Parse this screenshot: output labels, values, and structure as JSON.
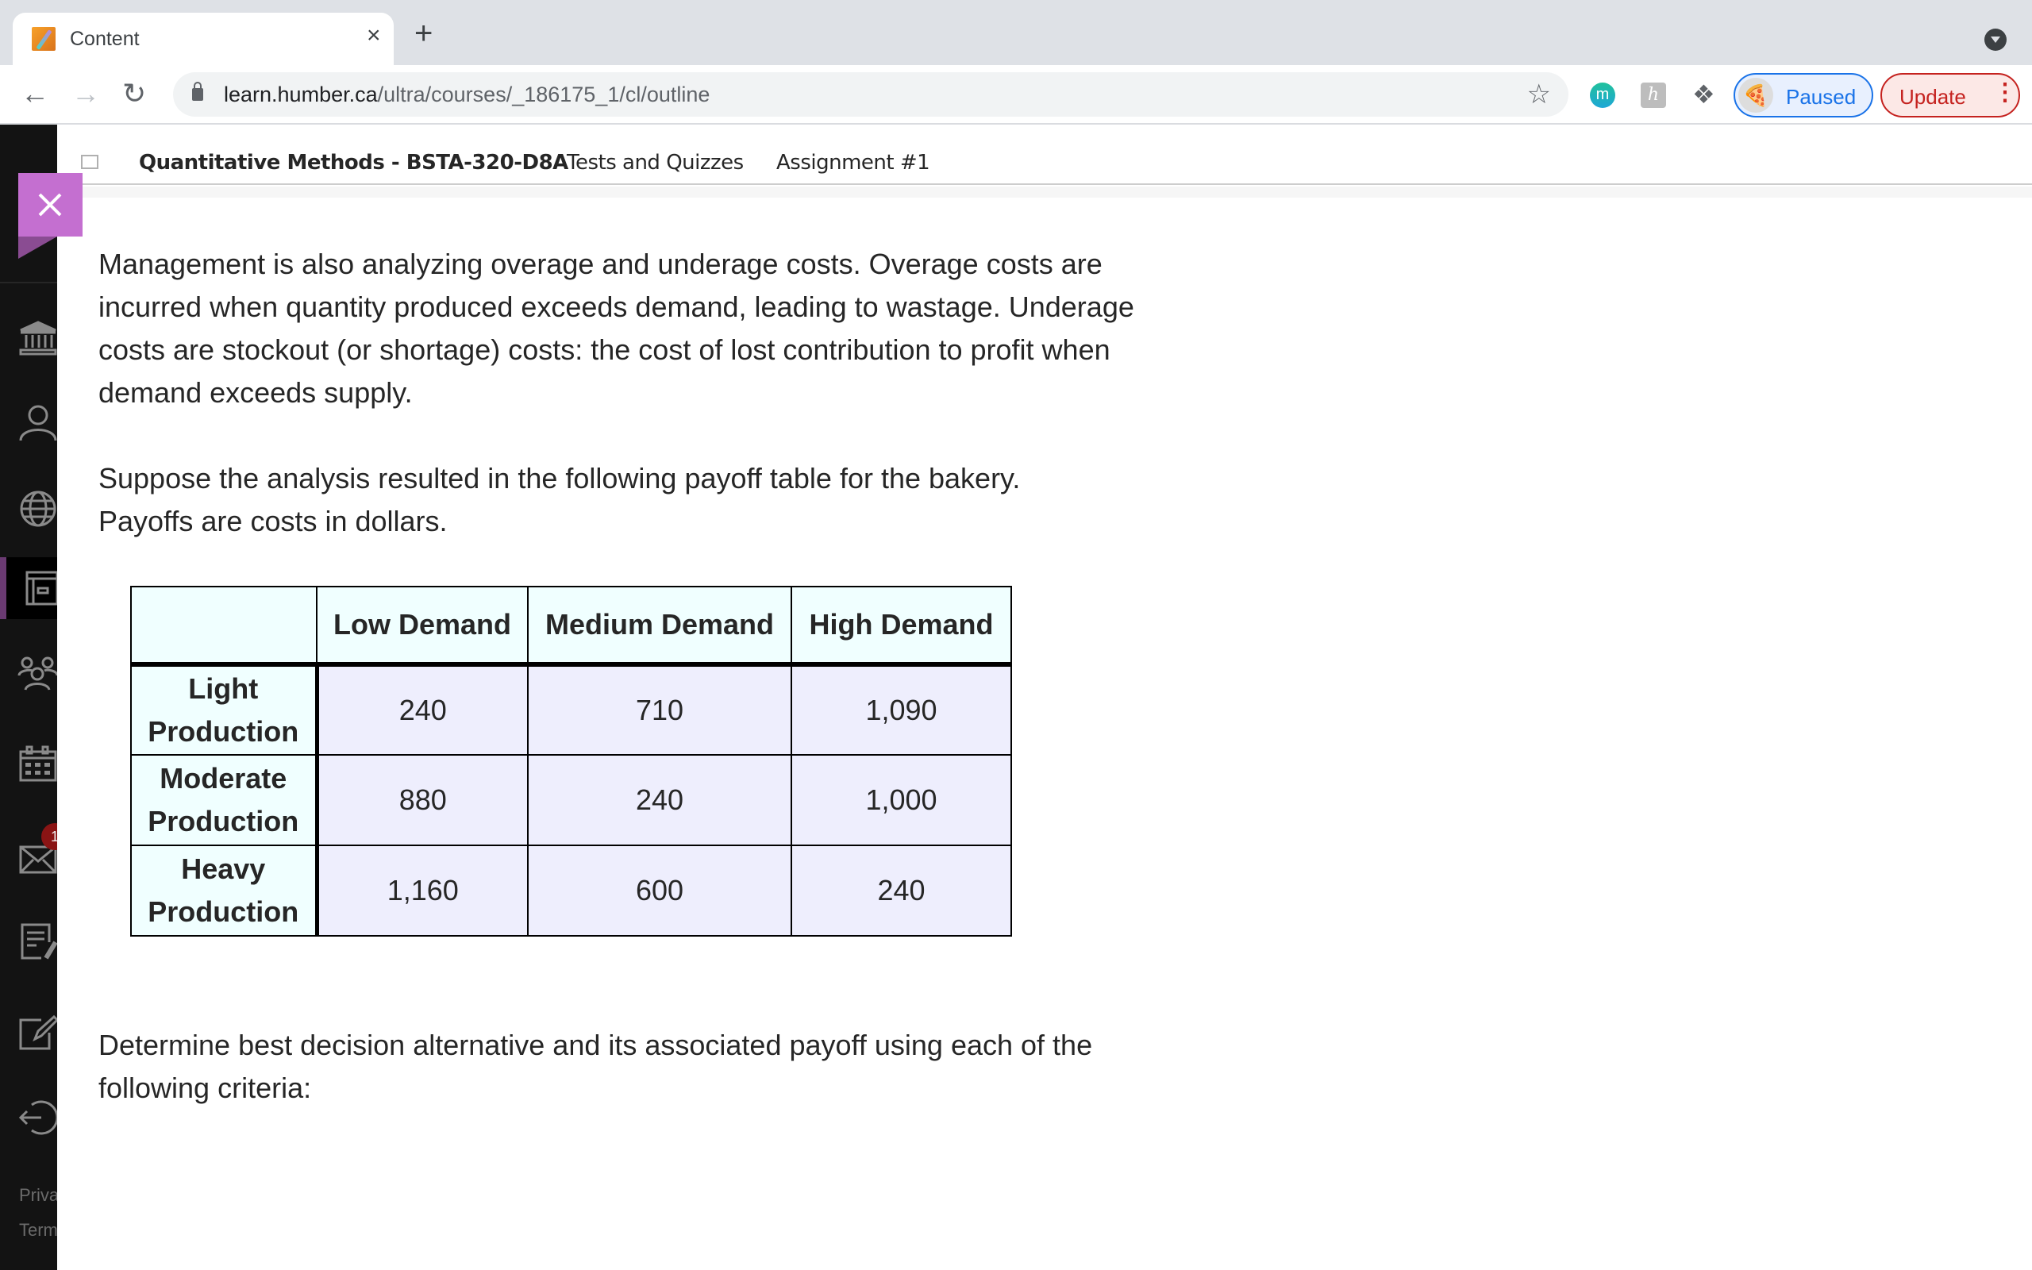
{
  "browser": {
    "tab": {
      "title": "Content",
      "favicon": "pencil-icon",
      "close": "×"
    },
    "new_tab": "+",
    "url_host": "learn.humber.ca",
    "url_path": "/ultra/courses/_186175_1/cl/outline",
    "extensions": [
      {
        "name": "m-extension",
        "label": "m"
      },
      {
        "name": "h-extension",
        "label": "h"
      },
      {
        "name": "extensions-puzzle-icon",
        "label": ""
      }
    ],
    "profile_label": "Paused",
    "update_label": "Update"
  },
  "sidebar": {
    "icons": [
      "institution-icon",
      "profile-icon",
      "globe-icon",
      "courses-icon",
      "groups-icon",
      "calendar-icon",
      "messages-icon",
      "grades-icon",
      "edit-icon",
      "sign-out-icon"
    ],
    "messages_badge": "1",
    "footer": [
      "Privacy",
      "Terms"
    ]
  },
  "header": {
    "course": "Quantitative Methods - BSTA-320-D8A",
    "breadcrumbs": [
      "Tests and Quizzes",
      "Assignment #1"
    ]
  },
  "content": {
    "paragraph1": "Management is also analyzing overage and underage costs. Overage costs are incurred when quantity produced exceeds demand, leading to wastage. Underage costs are stockout (or shortage) costs: the cost of lost contribution to profit when demand exceeds supply.",
    "paragraph2_line1": "Suppose the analysis resulted in the following payoff table for the bakery.",
    "paragraph2_line2": "Payoffs are costs in dollars.",
    "paragraph3": "Determine best decision alternative and its associated payoff using each of the following criteria:"
  },
  "table": {
    "columns": [
      "",
      "Low Demand",
      "Medium Demand",
      "High Demand"
    ],
    "rows": [
      {
        "label_line1": "Light",
        "label_line2": "Production",
        "values": [
          "240",
          "710",
          "1,090"
        ]
      },
      {
        "label_line1": "Moderate",
        "label_line2": "Production",
        "values": [
          "880",
          "240",
          "1,000"
        ]
      },
      {
        "label_line1": "Heavy",
        "label_line2": "Production",
        "values": [
          "1,160",
          "600",
          "240"
        ]
      }
    ]
  }
}
